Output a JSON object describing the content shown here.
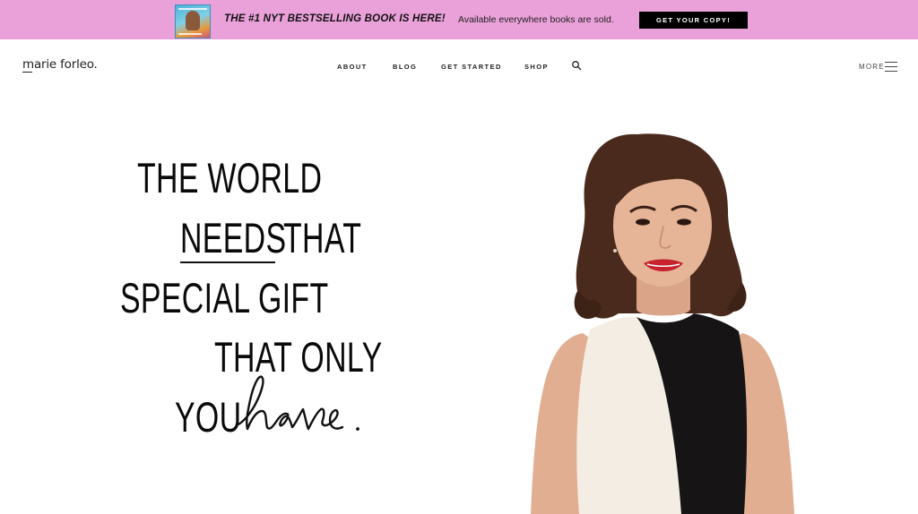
{
  "promo": {
    "headline": "THE #1 NYT BESTSELLING BOOK IS HERE!",
    "subtext": "Available everywhere books are sold.",
    "cta_label": "GET YOUR COPY!",
    "background_color": "#eaa1d9",
    "book_icon": "book-cover-image"
  },
  "header": {
    "logo": "marie forleo.",
    "nav": [
      "ABOUT",
      "BLOG",
      "GET STARTED",
      "SHOP"
    ],
    "search_icon": "search-icon",
    "more_label": "MORE",
    "menu_icon": "hamburger-menu-icon"
  },
  "hero": {
    "line1": "THE WORLD",
    "line2_underlined": "NEEDS",
    "line2_rest": "THAT",
    "line3": "SPECIAL GIFT",
    "line4": "THAT ONLY",
    "line5_prefix": "YOU",
    "line5_script": "have.",
    "image": "portrait-photo"
  }
}
